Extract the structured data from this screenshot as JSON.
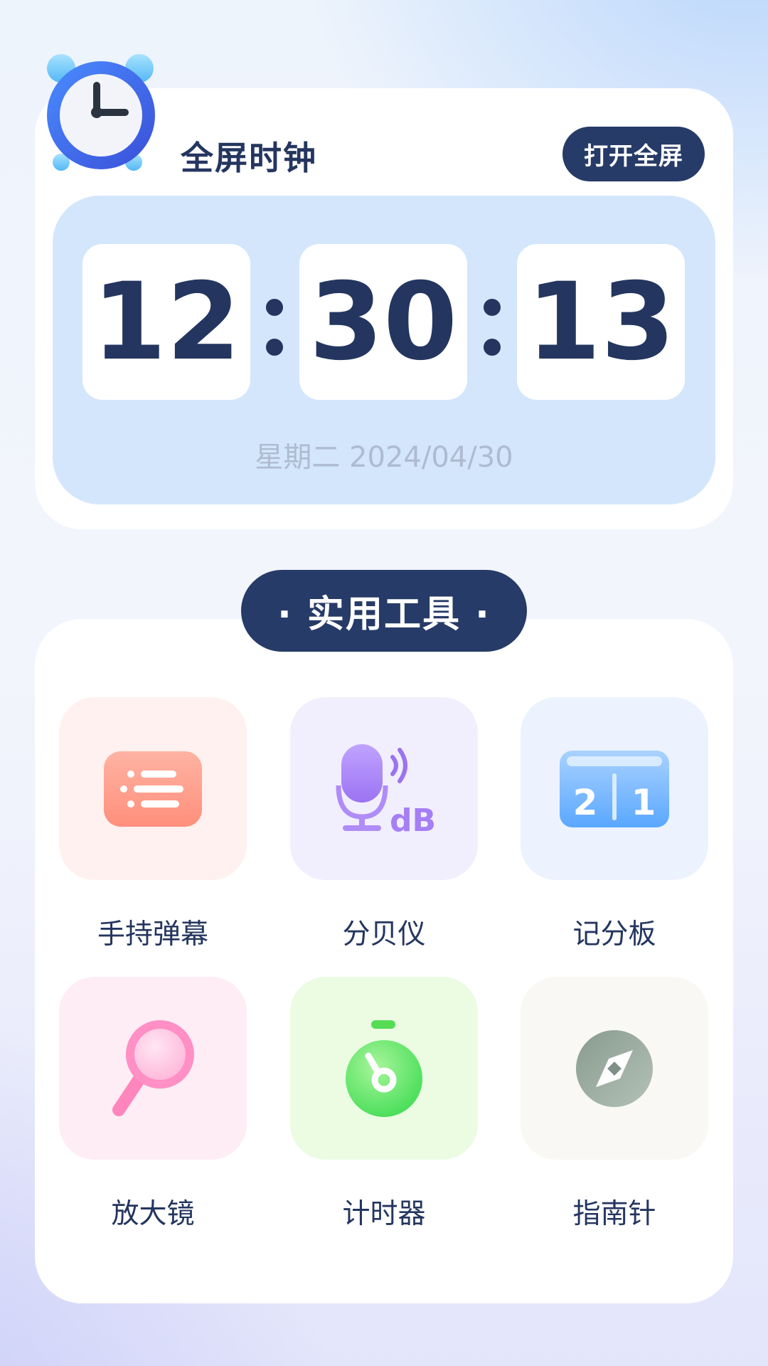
{
  "clock_card": {
    "title": "全屏时钟",
    "open_fullscreen_label": "打开全屏",
    "hours": "12",
    "minutes": "30",
    "seconds": "13",
    "date": "星期二 2024/04/30"
  },
  "tools": {
    "header": "· 实用工具 ·",
    "items": [
      {
        "label": "手持弹幕",
        "icon": "danmaku-icon",
        "tile_color": "#fff1ef"
      },
      {
        "label": "分贝仪",
        "icon": "decibel-meter-icon",
        "tile_color": "#f1effd"
      },
      {
        "label": "记分板",
        "icon": "scoreboard-icon",
        "tile_color": "#ecf3fe"
      },
      {
        "label": "放大镜",
        "icon": "magnifier-icon",
        "tile_color": "#feedf5"
      },
      {
        "label": "计时器",
        "icon": "stopwatch-icon",
        "tile_color": "#ebfce3"
      },
      {
        "label": "指南针",
        "icon": "compass-icon",
        "tile_color": "#f9f8f4"
      }
    ],
    "decibel_unit": "dB",
    "scoreboard_left": "2",
    "scoreboard_right": "1"
  },
  "colors": {
    "navy": "#263b67",
    "clock_face": "#d4e6fc"
  }
}
